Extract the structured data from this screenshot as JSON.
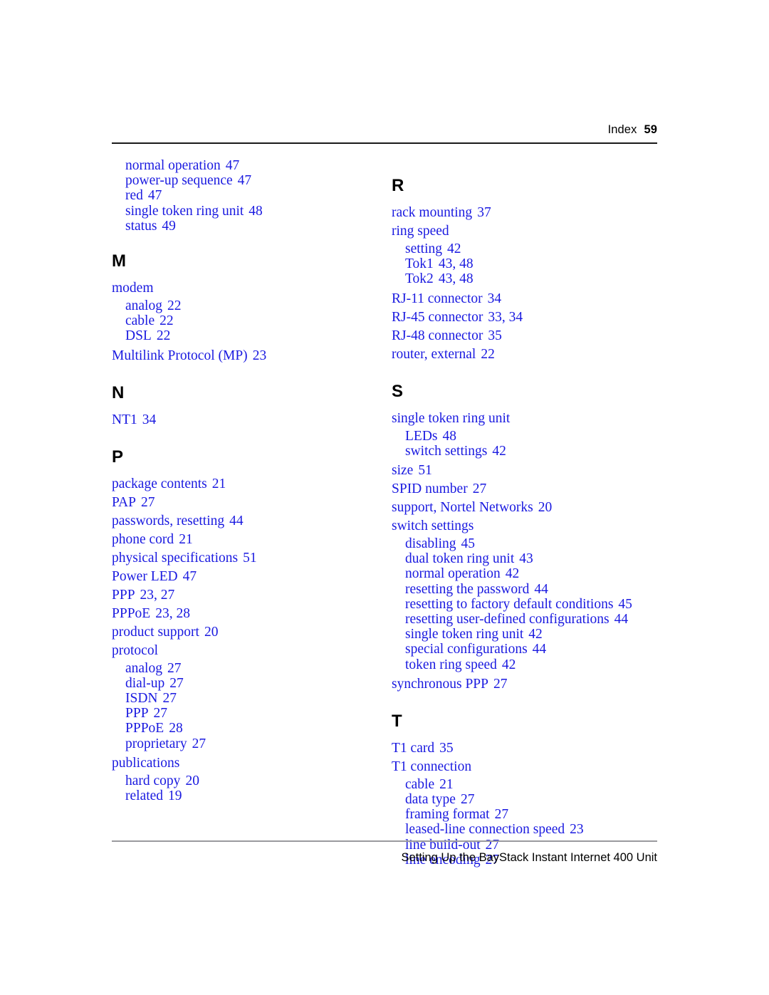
{
  "header": {
    "label": "Index",
    "page_number": "59"
  },
  "footer": {
    "text": "Setting Up the BayStack Instant Internet 400 Unit"
  },
  "colors": {
    "entry_blue": "#1a1ae0",
    "letter_black": "#000000",
    "rule_top": "#1a1a1a",
    "rule_bottom": "#9a9a9e",
    "page_background": "#ffffff"
  },
  "columns": {
    "left": {
      "continued_entries": [
        {
          "text": "normal operation",
          "pages": "47",
          "level": "sub"
        },
        {
          "text": "power-up sequence",
          "pages": "47",
          "level": "sub"
        },
        {
          "text": "red",
          "pages": "47",
          "level": "sub"
        },
        {
          "text": "single token ring unit",
          "pages": "48",
          "level": "sub"
        },
        {
          "text": "status",
          "pages": "49",
          "level": "sub"
        }
      ],
      "sections": [
        {
          "letter": "M",
          "entries": [
            {
              "text": "modem",
              "pages": "",
              "level": "head"
            },
            {
              "text": "analog",
              "pages": "22",
              "level": "sub"
            },
            {
              "text": "cable",
              "pages": "22",
              "level": "sub"
            },
            {
              "text": "DSL",
              "pages": "22",
              "level": "sub"
            },
            {
              "text": "Multilink Protocol (MP)",
              "pages": "23",
              "level": "head"
            }
          ]
        },
        {
          "letter": "N",
          "entries": [
            {
              "text": "NT1",
              "pages": "34",
              "level": "head"
            }
          ]
        },
        {
          "letter": "P",
          "entries": [
            {
              "text": "package contents",
              "pages": "21",
              "level": "head"
            },
            {
              "text": "PAP",
              "pages": "27",
              "level": "head"
            },
            {
              "text": "passwords, resetting",
              "pages": "44",
              "level": "head"
            },
            {
              "text": "phone cord",
              "pages": "21",
              "level": "head"
            },
            {
              "text": "physical specifications",
              "pages": "51",
              "level": "head"
            },
            {
              "text": "Power LED",
              "pages": "47",
              "level": "head"
            },
            {
              "text": "PPP",
              "pages": "23, 27",
              "level": "head"
            },
            {
              "text": "PPPoE",
              "pages": "23, 28",
              "level": "head"
            },
            {
              "text": "product support",
              "pages": "20",
              "level": "head"
            },
            {
              "text": "protocol",
              "pages": "",
              "level": "head"
            },
            {
              "text": "analog",
              "pages": "27",
              "level": "sub"
            },
            {
              "text": "dial-up",
              "pages": "27",
              "level": "sub"
            },
            {
              "text": "ISDN",
              "pages": "27",
              "level": "sub"
            },
            {
              "text": "PPP",
              "pages": "27",
              "level": "sub"
            },
            {
              "text": "PPPoE",
              "pages": "28",
              "level": "sub"
            },
            {
              "text": "proprietary",
              "pages": "27",
              "level": "sub"
            },
            {
              "text": "publications",
              "pages": "",
              "level": "head"
            },
            {
              "text": "hard copy",
              "pages": "20",
              "level": "sub"
            },
            {
              "text": "related",
              "pages": "19",
              "level": "sub"
            }
          ]
        }
      ]
    },
    "right": {
      "continued_entries": [],
      "sections": [
        {
          "letter": "R",
          "entries": [
            {
              "text": "rack mounting",
              "pages": "37",
              "level": "head"
            },
            {
              "text": "ring speed",
              "pages": "",
              "level": "head"
            },
            {
              "text": "setting",
              "pages": "42",
              "level": "sub"
            },
            {
              "text": "Tok1",
              "pages": "43, 48",
              "level": "sub"
            },
            {
              "text": "Tok2",
              "pages": "43, 48",
              "level": "sub"
            },
            {
              "text": "RJ-11 connector",
              "pages": "34",
              "level": "head"
            },
            {
              "text": "RJ-45 connector",
              "pages": "33, 34",
              "level": "head"
            },
            {
              "text": "RJ-48 connector",
              "pages": "35",
              "level": "head"
            },
            {
              "text": "router, external",
              "pages": "22",
              "level": "head"
            }
          ]
        },
        {
          "letter": "S",
          "entries": [
            {
              "text": "single token ring unit",
              "pages": "",
              "level": "head"
            },
            {
              "text": "LEDs",
              "pages": "48",
              "level": "sub"
            },
            {
              "text": "switch settings",
              "pages": "42",
              "level": "sub"
            },
            {
              "text": "size",
              "pages": "51",
              "level": "head"
            },
            {
              "text": "SPID number",
              "pages": "27",
              "level": "head"
            },
            {
              "text": "support, Nortel Networks",
              "pages": "20",
              "level": "head"
            },
            {
              "text": "switch settings",
              "pages": "",
              "level": "head"
            },
            {
              "text": "disabling",
              "pages": "45",
              "level": "sub"
            },
            {
              "text": "dual token ring unit",
              "pages": "43",
              "level": "sub"
            },
            {
              "text": "normal operation",
              "pages": "42",
              "level": "sub"
            },
            {
              "text": "resetting the password",
              "pages": "44",
              "level": "sub"
            },
            {
              "text": "resetting to factory default conditions",
              "pages": "45",
              "level": "sub"
            },
            {
              "text": "resetting user-defined configurations",
              "pages": "44",
              "level": "sub"
            },
            {
              "text": "single token ring unit",
              "pages": "42",
              "level": "sub"
            },
            {
              "text": "special configurations",
              "pages": "44",
              "level": "sub"
            },
            {
              "text": "token ring speed",
              "pages": "42",
              "level": "sub"
            },
            {
              "text": "synchronous PPP",
              "pages": "27",
              "level": "head"
            }
          ]
        },
        {
          "letter": "T",
          "entries": [
            {
              "text": "T1 card",
              "pages": "35",
              "level": "head"
            },
            {
              "text": "T1 connection",
              "pages": "",
              "level": "head"
            },
            {
              "text": "cable",
              "pages": "21",
              "level": "sub"
            },
            {
              "text": "data type",
              "pages": "27",
              "level": "sub"
            },
            {
              "text": "framing format",
              "pages": "27",
              "level": "sub"
            },
            {
              "text": "leased-line connection speed",
              "pages": "23",
              "level": "sub"
            },
            {
              "text": "line build-out",
              "pages": "27",
              "level": "sub"
            },
            {
              "text": "line encoding",
              "pages": "27",
              "level": "sub"
            }
          ]
        }
      ]
    }
  }
}
